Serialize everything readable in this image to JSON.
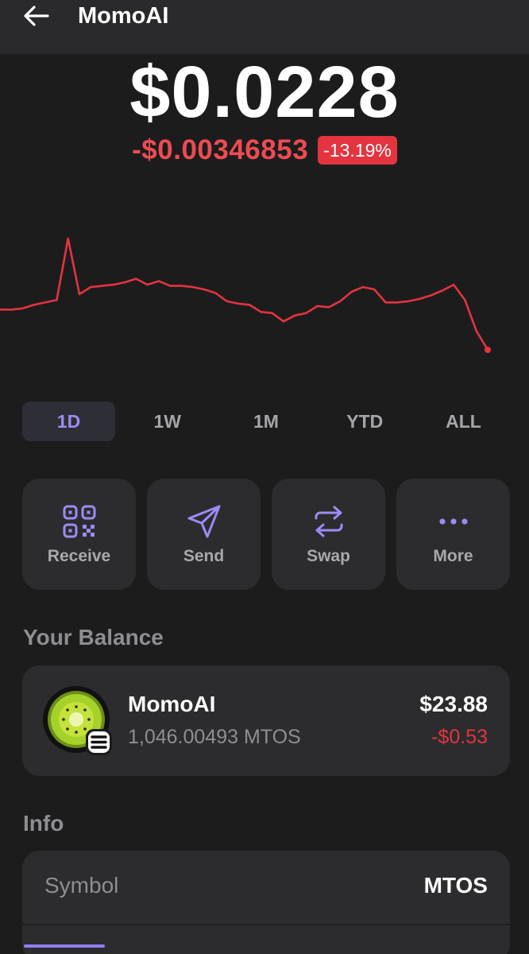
{
  "header": {
    "title": "MomoAI",
    "back_icon": "arrow-left-icon"
  },
  "price": {
    "current": "$0.0228",
    "change": "-$0.00346853",
    "change_pct": "-13.19%"
  },
  "chart_data": {
    "type": "line",
    "title": "",
    "xlabel": "",
    "ylabel": "",
    "color": "#e3343f",
    "grid": false,
    "y": [
      0.0262,
      0.0262,
      0.0263,
      0.0266,
      0.0268,
      0.027,
      0.0322,
      0.0275,
      0.0281,
      0.0282,
      0.0283,
      0.0285,
      0.0288,
      0.0283,
      0.0286,
      0.0282,
      0.0282,
      0.0281,
      0.0279,
      0.0276,
      0.0269,
      0.0267,
      0.0266,
      0.026,
      0.0259,
      0.0252,
      0.0257,
      0.0259,
      0.0265,
      0.0264,
      0.0269,
      0.0277,
      0.0281,
      0.0279,
      0.0268,
      0.0268,
      0.0269,
      0.0271,
      0.0274,
      0.0278,
      0.0283,
      0.027,
      0.0244,
      0.0228
    ]
  },
  "ranges": {
    "items": [
      "1D",
      "1W",
      "1M",
      "YTD",
      "ALL"
    ],
    "active": "1D"
  },
  "actions": {
    "receive": "Receive",
    "send": "Send",
    "swap": "Swap",
    "more": "More",
    "accent": "#9d8bf4"
  },
  "balance": {
    "section_title": "Your Balance",
    "token_name": "MomoAI",
    "token_amount": "1,046.00493 MTOS",
    "usd_value": "$23.88",
    "usd_change": "-$0.53"
  },
  "info": {
    "section_title": "Info",
    "rows": [
      {
        "label": "Symbol",
        "value": "MTOS"
      }
    ]
  }
}
